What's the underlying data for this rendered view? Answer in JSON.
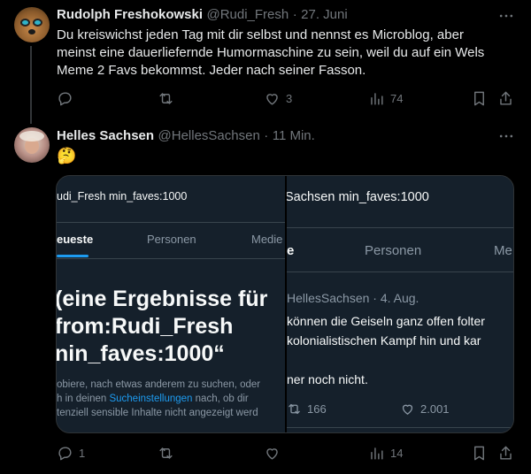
{
  "tweet1": {
    "display_name": "Rudolph Freshokowski",
    "handle": "@Rudi_Fresh",
    "sep": "·",
    "time": "27. Juni",
    "text_lines": [
      "Du kreiswichst jeden Tag mit dir selbst und nennst es Microblog, aber",
      "meinst eine dauerliefernde Humormaschine zu sein, weil du auf ein Wels",
      "Meme 2 Favs bekommst. Jeder nach seiner Fasson."
    ],
    "likes": "3",
    "views": "74"
  },
  "tweet2": {
    "display_name": "Helles Sachsen",
    "handle": "@HellesSachsen",
    "sep": "·",
    "time": "11 Min.",
    "text": "🤔",
    "replies": "1",
    "views": "14"
  },
  "screenshot_left": {
    "search_query": "udi_Fresh min_faves:1000",
    "tab_active": "eueste",
    "tab_2": "Personen",
    "tab_3": "Medie",
    "heading_lines": [
      "(eine Ergebnisse für",
      "from:Rudi_Fresh",
      "nin_faves:1000“"
    ],
    "body_line_1": "obiere, nach etwas anderem zu suchen, oder",
    "body_line_2_pre": "h in deinen ",
    "body_link": "Sucheinstellungen",
    "body_line_2_post": " nach, ob dir",
    "body_line_3": "tenziell sensible Inhalte nicht angezeigt werd"
  },
  "screenshot_right": {
    "search_query": "Sachsen min_faves:1000",
    "tab_active": "e",
    "tab_2": "Personen",
    "tab_3": "Me",
    "meta": "HellesSachsen · 4. Aug.",
    "lines": [
      "können die Geiseln ganz offen folter",
      "kolonialistischen Kampf hin und kar",
      "ner noch nicht."
    ],
    "retweets": "166",
    "likes": "2.001"
  },
  "colors": {
    "background": "#000000",
    "text": "#e7e9ea",
    "muted": "#71767b",
    "link": "#1d9bf0",
    "card_bg": "#15202b"
  },
  "icons": [
    "more-icon",
    "reply-icon",
    "retweet-icon",
    "like-icon",
    "views-icon",
    "bookmark-icon",
    "share-icon"
  ]
}
